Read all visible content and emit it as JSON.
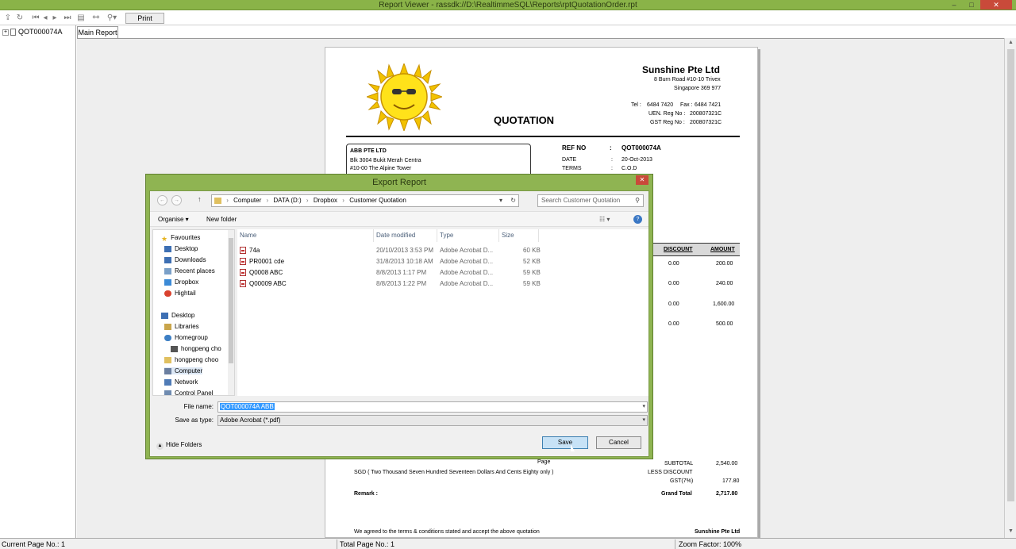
{
  "window": {
    "title": "Report Viewer - rassdk://D:\\RealtimmeSQL\\Reports\\rptQuotationOrder.rpt",
    "minimize": "–",
    "maximize": "□",
    "close": "✕"
  },
  "toolbar": {
    "print_label": "Print",
    "icons": [
      "export-icon",
      "refresh-icon",
      "first-page-icon",
      "prev-page-icon",
      "next-page-icon",
      "last-page-icon",
      "goto-page-icon",
      "find-icon",
      "zoom-icon"
    ]
  },
  "tree": {
    "expand": "+",
    "item": "QOT000074A"
  },
  "tab": {
    "label": "Main Report"
  },
  "report": {
    "company": "Sunshine Pte Ltd",
    "address1": "8 Burn Road #10-10 Trivex",
    "address2": "Singapore 369 977",
    "tel_label": "Tel :",
    "tel": "6484 7420",
    "fax_label": "Fax :",
    "fax": "6484 7421",
    "uen_label": "UEN. Reg No :",
    "uen": "200807321C",
    "gst_label": "GST Reg  No :",
    "gst": "200807321C",
    "title": "QUOTATION",
    "customer": {
      "name": "ABB PTE LTD",
      "line1": "Blk 3004 Bukit Merah Centra",
      "line2": "#10-00 The Alpine Tower"
    },
    "ref_label": "REF NO",
    "ref_colon": ":",
    "ref": "QOT000074A",
    "date_label": "DATE",
    "date_colon": ":",
    "date": "20-Oct-2013",
    "terms_label": "TERMS",
    "terms_colon": ":",
    "terms": "C.O.D",
    "col_discount": "DISCOUNT",
    "col_amount": "AMOUNT",
    "rows": [
      {
        "discount": "0.00",
        "amount": "200.00"
      },
      {
        "discount": "0.00",
        "amount": "240.00"
      },
      {
        "discount": "0.00",
        "amount": "1,600.00"
      },
      {
        "discount": "0.00",
        "amount": "500.00"
      }
    ],
    "page_label": "Page",
    "subtotal_label": "SUBTOTAL",
    "subtotal": "2,540.00",
    "less_discount_label": "LESS DISCOUNT",
    "gst_pct_label": "GST(7%)",
    "gst_amount": "177.80",
    "grand_total_label": "Grand Total",
    "grand_total": "2,717.80",
    "amount_words": "SGD  ( Two Thousand Seven Hundred Seventeen Dollars And Cents Eighty only )",
    "remark_label": "Remark :",
    "agreement": "We agreed to the terms & conditions stated and accept the above quotation",
    "footer_company": "Sunshine Pte Ltd"
  },
  "status": {
    "current_page": "Current Page No.: 1",
    "total_page": "Total Page No.: 1",
    "zoom": "Zoom Factor: 100%"
  },
  "dialog": {
    "title": "Export Report",
    "close": "✕",
    "back": "←",
    "forward": "→",
    "up": "↑",
    "path": [
      "Computer",
      "DATA (D:)",
      "Dropbox",
      "Customer Quotation"
    ],
    "path_sep": "›",
    "dropdown": "▾",
    "refresh": "↻",
    "search_placeholder": "Search Customer Quotation",
    "search_icon": "⚲",
    "organise": "Organise ▾",
    "new_folder": "New folder",
    "view": "☷ ▾",
    "help": "?",
    "nav": [
      {
        "label": "Favourites",
        "icon": "star-icon",
        "color": "#e6b422"
      },
      {
        "label": "Desktop",
        "icon": "desktop-icon",
        "color": "#3d6fb3"
      },
      {
        "label": "Downloads",
        "icon": "downloads-icon",
        "color": "#3d6fb3"
      },
      {
        "label": "Recent places",
        "icon": "recent-places-icon",
        "color": "#7aa0c8"
      },
      {
        "label": "Dropbox",
        "icon": "dropbox-icon",
        "color": "#3b8ad6"
      },
      {
        "label": "Hightail",
        "icon": "hightail-icon",
        "color": "#d9412e"
      },
      {
        "label": "Desktop",
        "icon": "desktop-icon",
        "color": "#3d6fb3"
      },
      {
        "label": "Libraries",
        "icon": "libraries-icon",
        "color": "#c9a54b"
      },
      {
        "label": "Homegroup",
        "icon": "homegroup-icon",
        "color": "#3d7fc4"
      },
      {
        "label": "hongpeng cho",
        "icon": "user-icon",
        "color": "#555555"
      },
      {
        "label": "hongpeng choo",
        "icon": "user-folder-icon",
        "color": "#e0c060"
      },
      {
        "label": "Computer",
        "icon": "computer-icon",
        "color": "#6b7fa0"
      },
      {
        "label": "Network",
        "icon": "network-icon",
        "color": "#4f7bb6"
      },
      {
        "label": "Control Panel",
        "icon": "control-panel-icon",
        "color": "#6f8bb0"
      }
    ],
    "columns": [
      "Name",
      "Date modified",
      "Type",
      "Size"
    ],
    "files": [
      {
        "name": "74a",
        "date": "20/10/2013 3:53 PM",
        "type": "Adobe Acrobat D...",
        "size": "60 KB"
      },
      {
        "name": "PR0001 cde",
        "date": "31/8/2013 10:18 AM",
        "type": "Adobe Acrobat D...",
        "size": "52 KB"
      },
      {
        "name": "Q0008 ABC",
        "date": "8/8/2013 1:17 PM",
        "type": "Adobe Acrobat D...",
        "size": "59 KB"
      },
      {
        "name": "Q00009 ABC",
        "date": "8/8/2013 1:22 PM",
        "type": "Adobe Acrobat D...",
        "size": "59 KB"
      }
    ],
    "file_name_label": "File name:",
    "file_name": "QOT000074A ABB",
    "save_type_label": "Save as type:",
    "save_type": "Adobe Acrobat (*.pdf)",
    "hide_folders": "Hide Folders",
    "save": "Save",
    "cancel": "Cancel"
  }
}
